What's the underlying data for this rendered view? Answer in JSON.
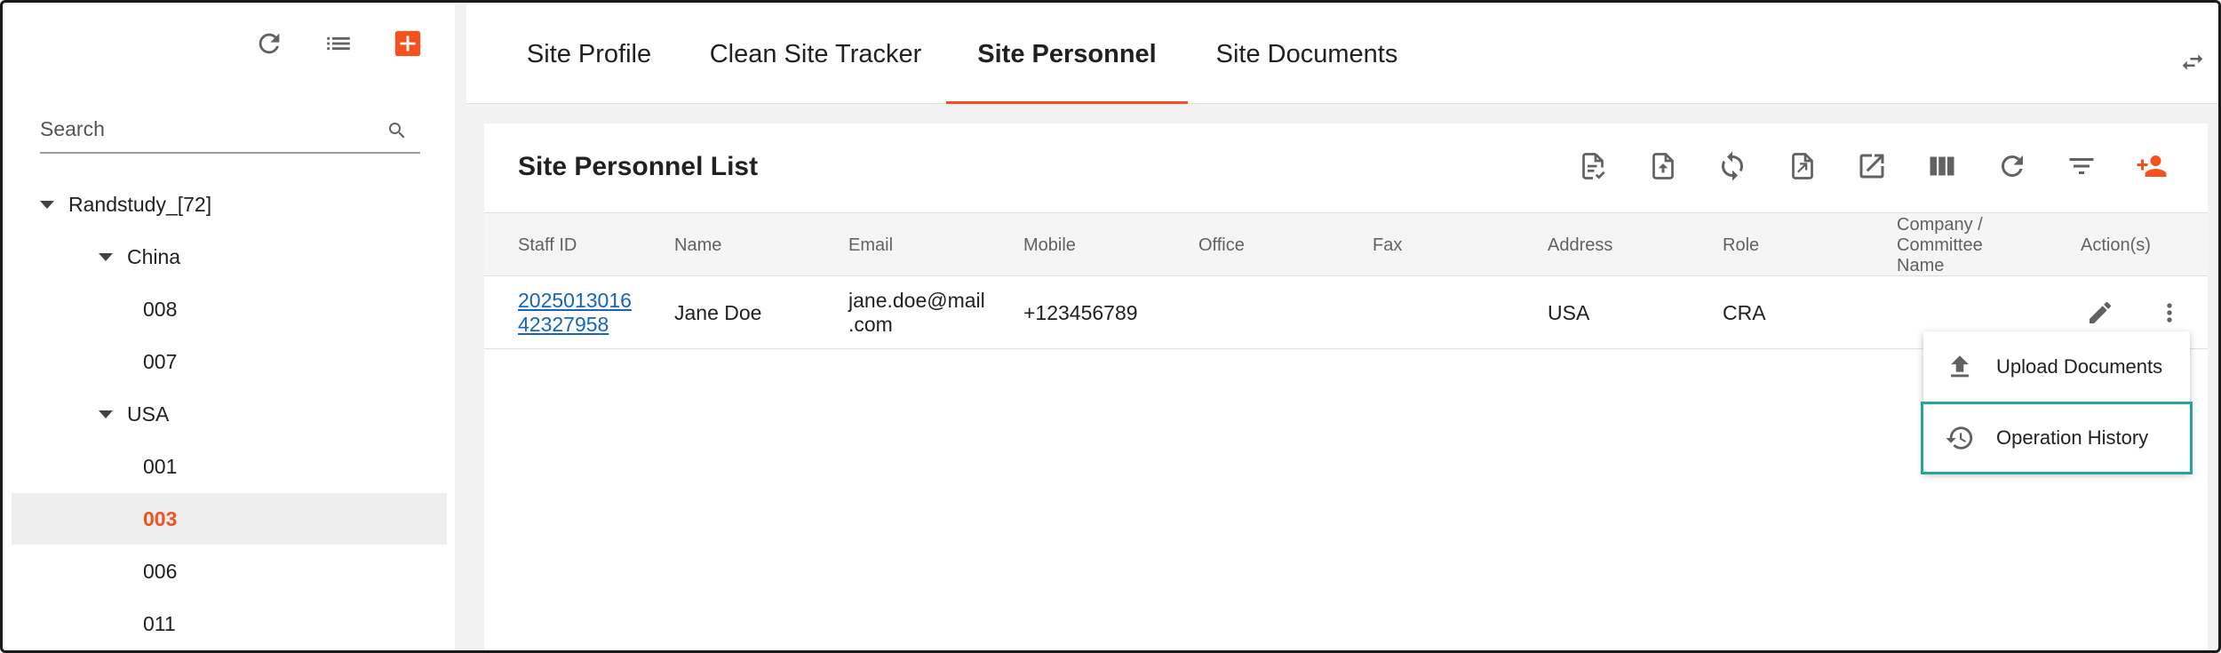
{
  "sidebar": {
    "icons": [
      "refresh-icon",
      "list-icon",
      "add-icon"
    ],
    "search": {
      "placeholder": "Search"
    },
    "tree": [
      {
        "label": "Randstudy_[72]",
        "expanded": true,
        "level": 0
      },
      {
        "label": "China",
        "expanded": true,
        "level": 1
      },
      {
        "label": "008",
        "level": 2
      },
      {
        "label": "007",
        "level": 2
      },
      {
        "label": "USA",
        "expanded": true,
        "level": 1
      },
      {
        "label": "001",
        "level": 2
      },
      {
        "label": "003",
        "level": 2,
        "selected": true
      },
      {
        "label": "006",
        "level": 2
      },
      {
        "label": "011",
        "level": 2
      }
    ]
  },
  "tabs": [
    {
      "label": "Site Profile"
    },
    {
      "label": "Clean Site Tracker"
    },
    {
      "label": "Site Personnel",
      "active": true
    },
    {
      "label": "Site Documents"
    }
  ],
  "panel": {
    "title": "Site Personnel List",
    "toolbar_icons": [
      "document-check-icon",
      "file-upload-icon",
      "sync-icon",
      "file-export-icon",
      "open-external-icon",
      "columns-icon",
      "refresh-icon",
      "filter-icon",
      "add-person-icon"
    ],
    "columns": [
      "Staff ID",
      "Name",
      "Email",
      "Mobile",
      "Office",
      "Fax",
      "Address",
      "Role",
      "Company / Committee Name",
      "Action(s)"
    ],
    "rows": [
      {
        "staff_id_line1": "2025013016",
        "staff_id_line2": "42327958",
        "name": "Jane Doe",
        "email_line1": "jane.doe@mail",
        "email_line2": ".com",
        "mobile": "+123456789",
        "office": "",
        "fax": "",
        "address": "USA",
        "role": "CRA",
        "company": ""
      }
    ]
  },
  "menu": {
    "items": [
      {
        "label": "Upload Documents",
        "icon": "upload-icon"
      },
      {
        "label": "Operation History",
        "icon": "history-icon",
        "highlighted": true
      }
    ]
  },
  "colors": {
    "accent": "#f4511e",
    "link": "#1565c0",
    "highlight": "#26a69a"
  }
}
